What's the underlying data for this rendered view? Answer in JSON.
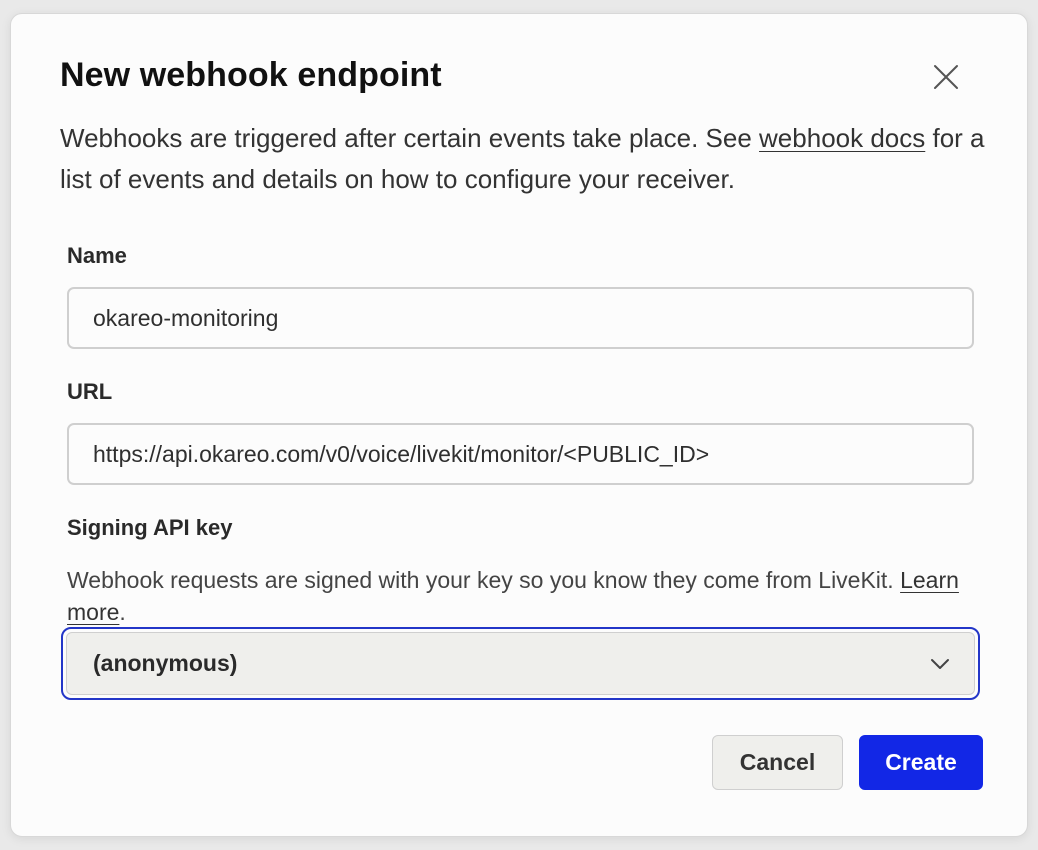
{
  "dialog": {
    "title": "New webhook endpoint",
    "close_icon": "close-icon",
    "description_before": "Webhooks are triggered after certain events take place. See ",
    "description_link": "webhook docs",
    "description_after": " for a list of events and details on how to configure your receiver."
  },
  "fields": {
    "name": {
      "label": "Name",
      "value": "okareo-monitoring"
    },
    "url": {
      "label": "URL",
      "value": "https://api.okareo.com/v0/voice/livekit/monitor/<PUBLIC_ID>"
    },
    "signing_key": {
      "label": "Signing API key",
      "help_text": "Webhook requests are signed with your key so you know they come from LiveKit. ",
      "help_link": "Learn more",
      "help_suffix": ".",
      "selected": "(anonymous)",
      "dropdown_icon": "chevron-down-icon"
    }
  },
  "actions": {
    "cancel_label": "Cancel",
    "create_label": "Create"
  },
  "colors": {
    "primary": "#1227e6",
    "focus_ring": "#2336c8"
  }
}
